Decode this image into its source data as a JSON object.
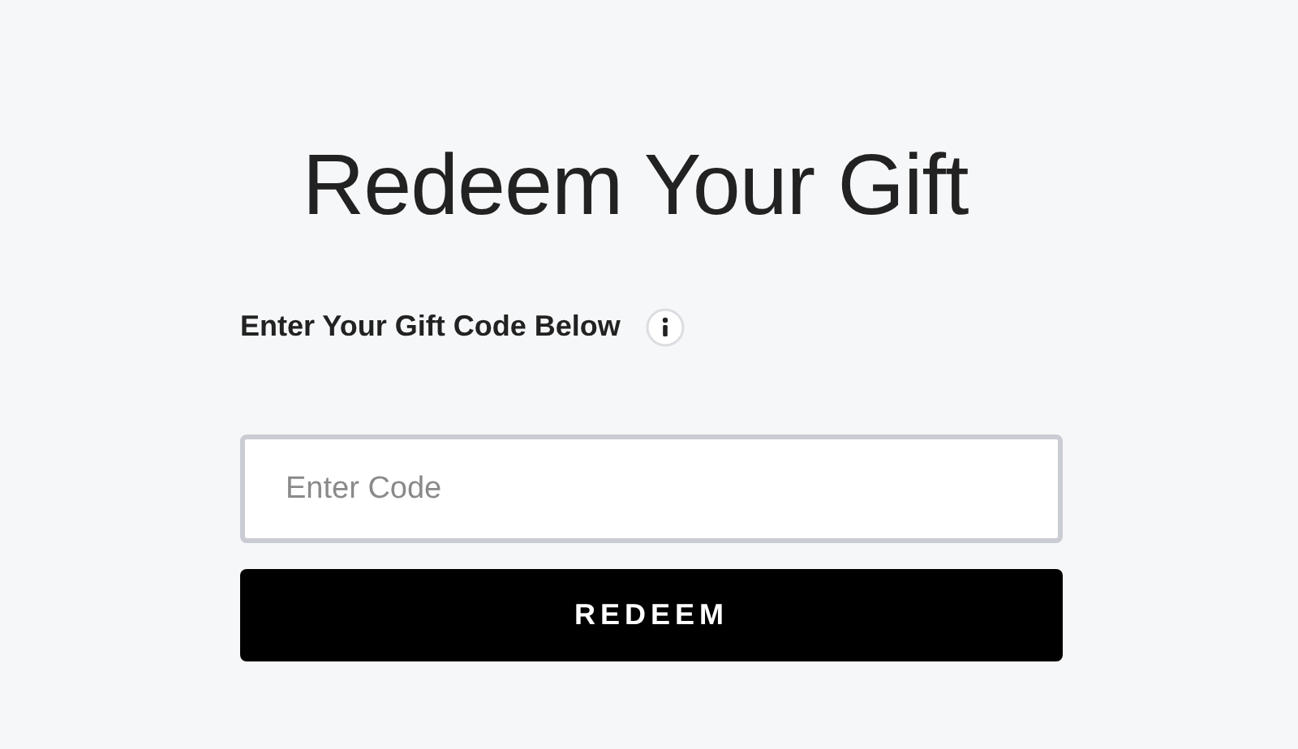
{
  "title": "Redeem Your Gift",
  "code_label": "Enter Your Gift Code Below",
  "code_field": {
    "placeholder": "Enter Code"
  },
  "redeem_button": "REDEEM"
}
